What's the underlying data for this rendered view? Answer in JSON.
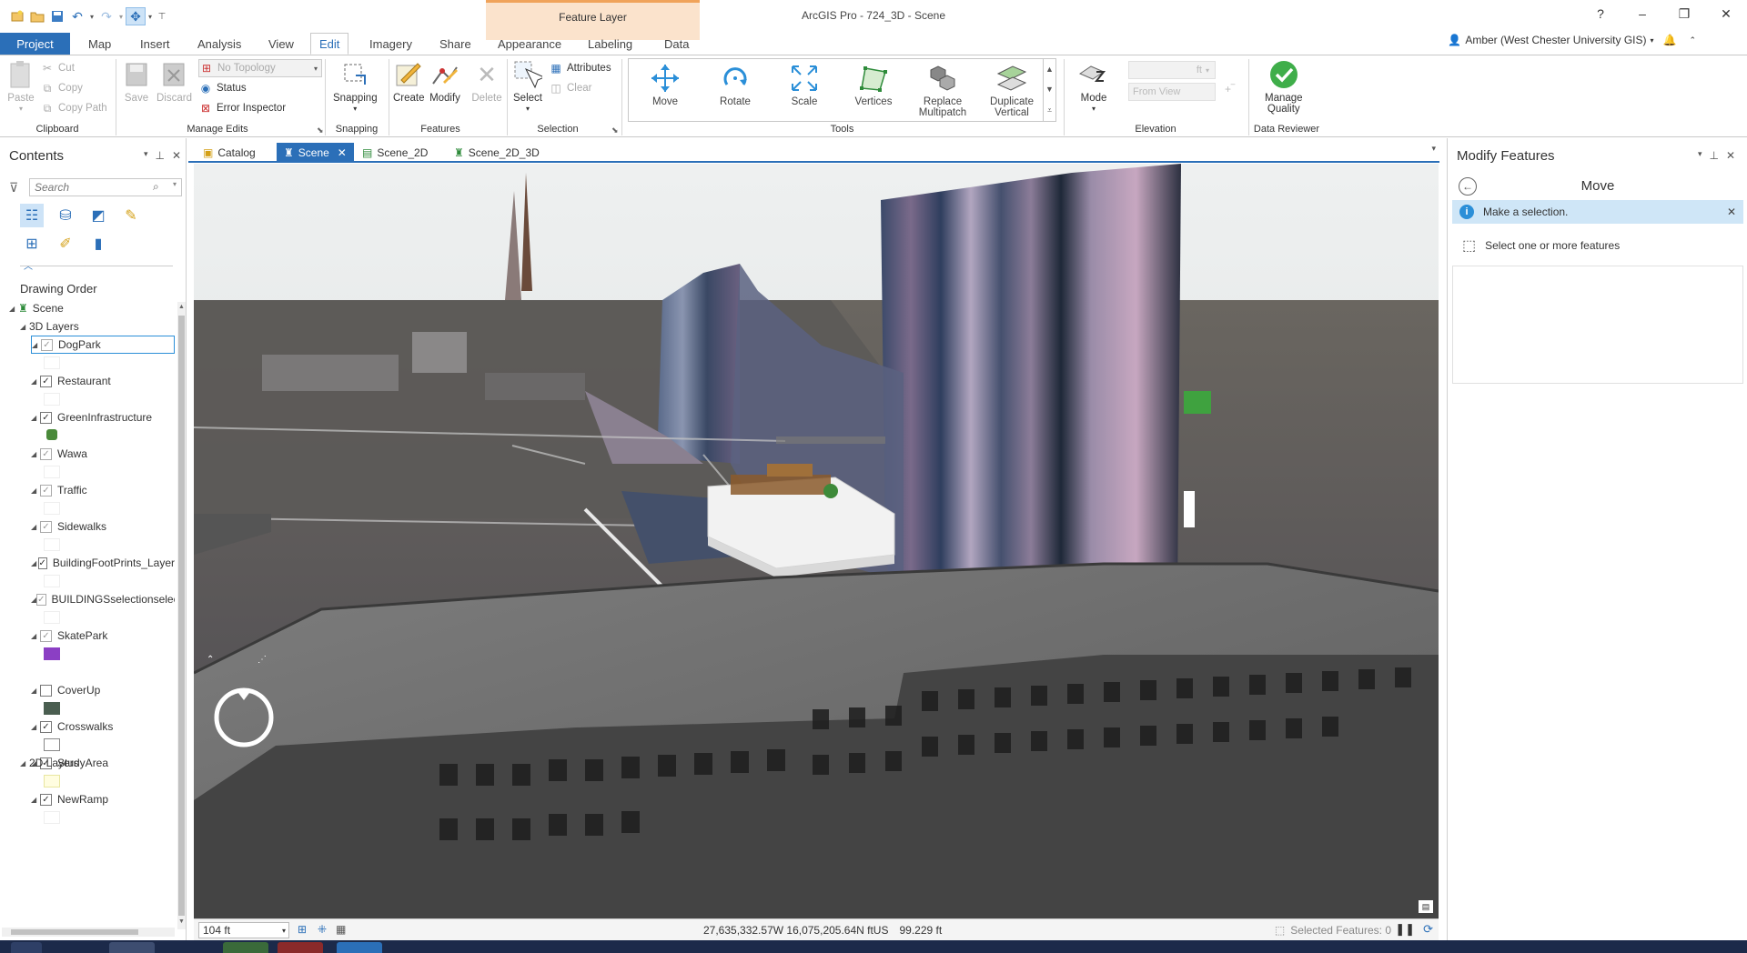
{
  "app": {
    "title": "ArcGIS Pro - 724_3D - Scene",
    "context_tab_group": "Feature Layer",
    "help": "?",
    "minimize": "–",
    "restore": "❐",
    "close": "✕"
  },
  "tabs": [
    "Project",
    "Map",
    "Insert",
    "Analysis",
    "View",
    "Edit",
    "Imagery",
    "Share",
    "Appearance",
    "Labeling",
    "Data"
  ],
  "active_tab": "Edit",
  "user": "Amber (West Chester University GIS)",
  "ribbon": {
    "clipboard": {
      "paste": "Paste",
      "cut": "Cut",
      "copy": "Copy",
      "copy_path": "Copy Path",
      "label": "Clipboard"
    },
    "manage_edits": {
      "save": "Save",
      "discard": "Discard",
      "topology": "No Topology",
      "status": "Status",
      "error_inspector": "Error Inspector",
      "label": "Manage Edits"
    },
    "snapping": {
      "snapping": "Snapping",
      "label": "Snapping"
    },
    "features": {
      "create": "Create",
      "modify": "Modify",
      "delete": "Delete",
      "label": "Features"
    },
    "selection": {
      "select": "Select",
      "attributes": "Attributes",
      "clear": "Clear",
      "label": "Selection"
    },
    "tools": {
      "label": "Tools",
      "items": [
        {
          "l1": "Move",
          "l2": ""
        },
        {
          "l1": "Rotate",
          "l2": ""
        },
        {
          "l1": "Scale",
          "l2": ""
        },
        {
          "l1": "Vertices",
          "l2": ""
        },
        {
          "l1": "Replace",
          "l2": "Multipatch"
        },
        {
          "l1": "Duplicate",
          "l2": "Vertical"
        }
      ]
    },
    "elevation": {
      "mode": "Mode",
      "from_view": "From View",
      "unit": "ft",
      "label": "Elevation"
    },
    "data_reviewer": {
      "manage": "Manage",
      "quality": "Quality",
      "label": "Data Reviewer"
    }
  },
  "contents": {
    "title": "Contents",
    "search_placeholder": "Search",
    "drawing_order": "Drawing Order",
    "tree": {
      "scene": "Scene",
      "layers_3d": "3D Layers",
      "layers_2d": "2D Layers",
      "items": [
        {
          "name": "DogPark",
          "checked": true,
          "selected": true
        },
        {
          "name": "Restaurant",
          "checked": true
        },
        {
          "name": "GreenInfrastructure",
          "checked": true
        },
        {
          "name": "Wawa",
          "checked": true
        },
        {
          "name": "Traffic",
          "checked": true
        },
        {
          "name": "Sidewalks",
          "checked": true
        },
        {
          "name": "BuildingFootPrints_Layer",
          "checked": true
        },
        {
          "name": "BUILDINGSselectionselec",
          "checked": true
        },
        {
          "name": "SkatePark",
          "checked": true
        },
        {
          "name": "CoverUp",
          "checked": false
        },
        {
          "name": "Crosswalks",
          "checked": true
        },
        {
          "name": "StudyArea",
          "checked": true
        },
        {
          "name": "NewRamp",
          "checked": true
        }
      ]
    }
  },
  "view_tabs": [
    "Catalog",
    "Scene",
    "Scene_2D",
    "Scene_2D_3D"
  ],
  "status_bar": {
    "scale": "104 ft",
    "coordinates": "27,635,332.57W 16,075,205.64N ftUS",
    "elevation": "99.229 ft",
    "selected": "Selected Features: 0"
  },
  "modify_features": {
    "title": "Modify Features",
    "tool": "Move",
    "message": "Make a selection.",
    "hint": "Select one or more features"
  },
  "colors": {
    "accent": "#2b6fb8",
    "context_tab": "#fbe3cc",
    "message_bar": "#cfe6f7",
    "green_swatch": "#4a8a3a",
    "purple_swatch": "#8b3fc4",
    "coverup_swatch": "#4a5e50"
  }
}
